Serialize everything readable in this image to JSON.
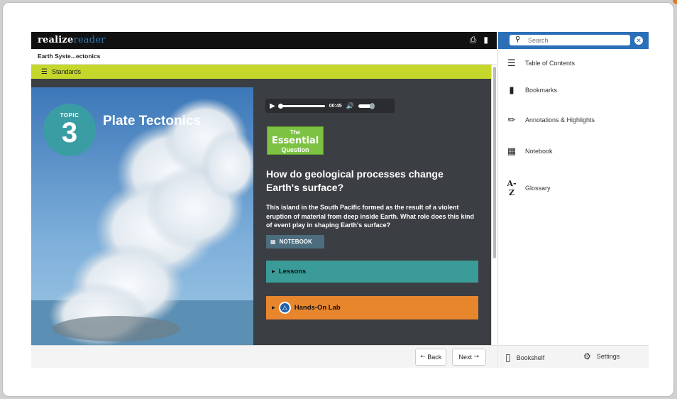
{
  "app": {
    "logo_bold": "realize",
    "logo_light": "reader"
  },
  "breadcrumb": "Earth Syste...ectonics",
  "standards_label": "Standards",
  "topic": {
    "label": "TOPIC",
    "number": "3",
    "title": "Plate Tectonics"
  },
  "audio": {
    "time": "00:45",
    "progress": 0.0,
    "volume": 0.7
  },
  "essential_question": {
    "line1": "The",
    "line2": "Essential",
    "line3": "Question"
  },
  "question": "How do geological processes change Earth's surface?",
  "description": "This island in the South Pacific formed as the result of a violent eruption of material from deep inside Earth. What role does this kind of event play in shaping Earth's surface?",
  "notebook_button": "NOTEBOOK",
  "lessons_label": "Lessons",
  "lab_label": "Hands-On Lab",
  "nav": {
    "back": "Back",
    "next": "Next"
  },
  "panel": {
    "search_placeholder": "Search",
    "items": [
      {
        "label": "Table of Contents",
        "icon": "list-icon"
      },
      {
        "label": "Bookmarks",
        "icon": "bookmark-icon"
      },
      {
        "label": "Annotations & Highlights",
        "icon": "pencil-icon"
      },
      {
        "label": "Notebook",
        "icon": "notebook-icon"
      },
      {
        "label": "Glossary",
        "icon": "az-icon",
        "icon_text": "A-Z"
      }
    ],
    "bottom": {
      "bookshelf": "Bookshelf",
      "settings": "Settings"
    }
  },
  "colors": {
    "accent_blue": "#2a6fb8",
    "standards_green": "#c5d72b",
    "teal": "#3a9b98",
    "orange": "#e8862e",
    "eq_green": "#7dc243"
  }
}
